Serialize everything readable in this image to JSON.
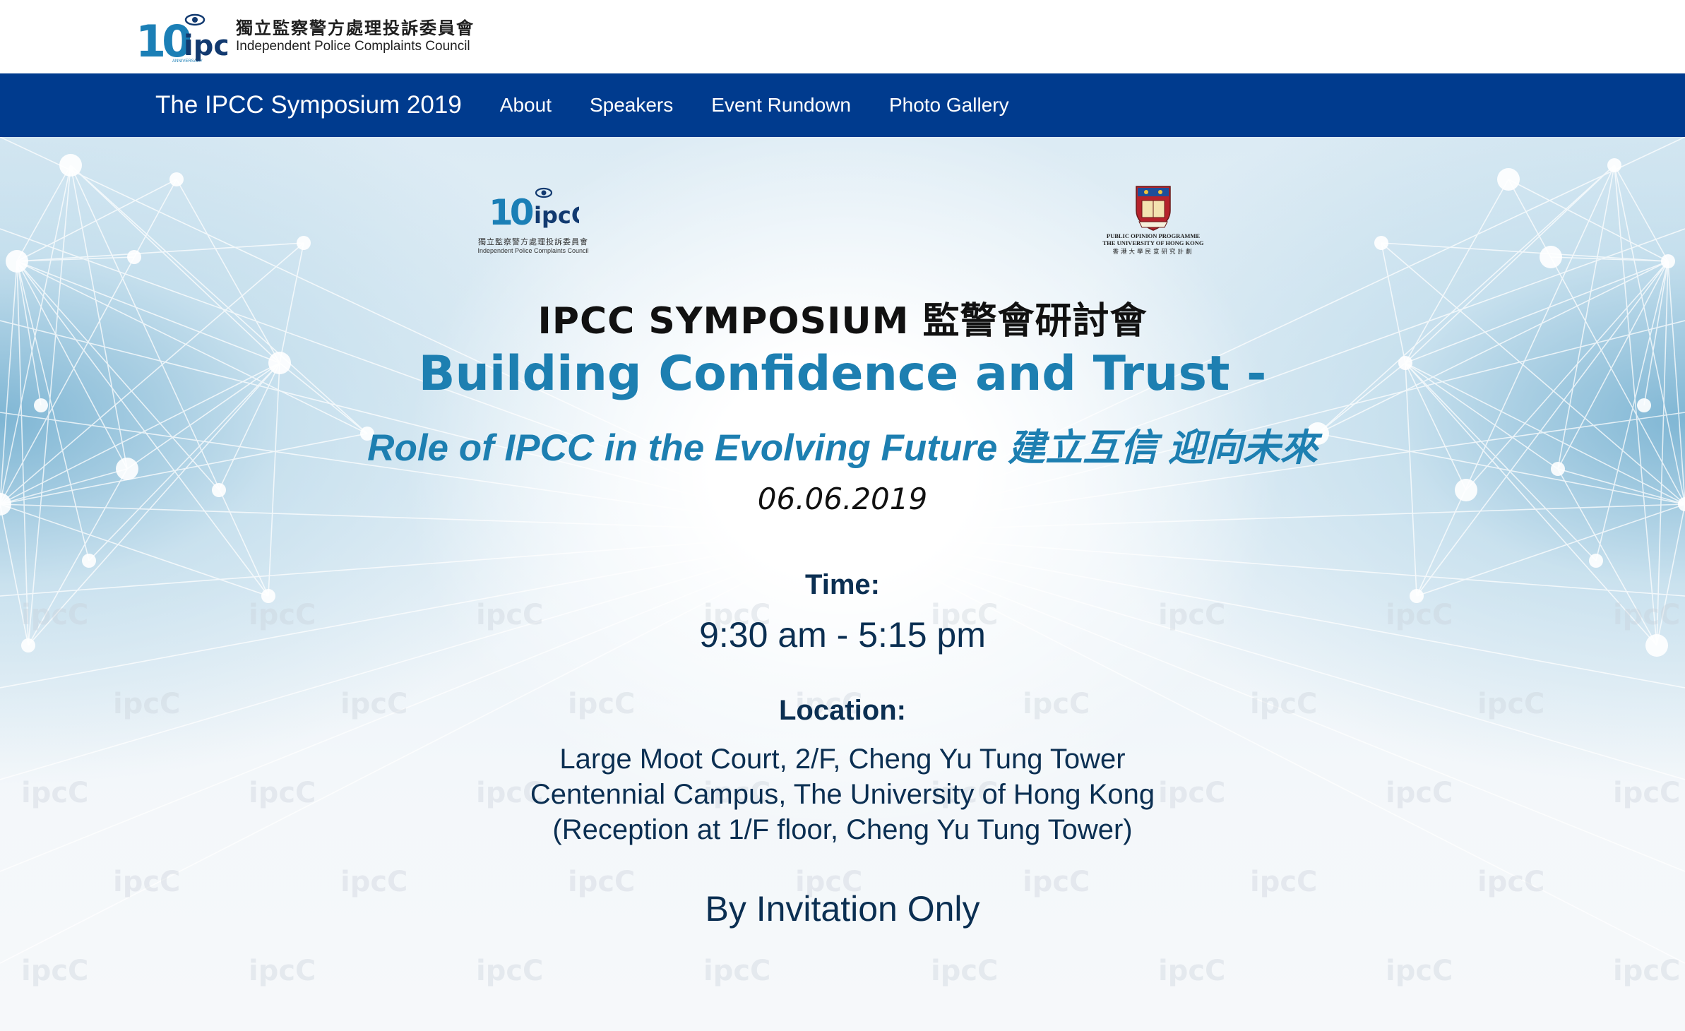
{
  "header": {
    "logo_chinese": "獨立監察警方處理投訴委員會",
    "logo_english": "Independent Police Complaints Council",
    "anniversary_mark": "10",
    "anniversary_small": "ANNIVERSARY"
  },
  "nav": {
    "title": "The IPCC Symposium 2019",
    "links": [
      "About",
      "Speakers",
      "Event Rundown",
      "Photo Gallery"
    ]
  },
  "hero": {
    "ipcc_logo": {
      "chinese": "獨立監察警方處理投訴委員會",
      "english": "Independent Police Complaints Council"
    },
    "hku_logo": {
      "line1": "PUBLIC OPINION PROGRAMME",
      "line2": "THE UNIVERSITY OF HONG KONG",
      "line3": "香港大學民意研究計劃"
    },
    "symposium_title": "IPCC SYMPOSIUM 監警會研討會",
    "main_title": "Building Confidence and Trust -",
    "subtitle": "Role of IPCC in the Evolving Future 建立互信 迎向未來",
    "date": "06.06.2019",
    "time_label": "Time:",
    "time_value": "9:30 am - 5:15 pm",
    "location_label": "Location:",
    "location_lines": [
      "Large Moot Court, 2/F, Cheng Yu Tung Tower",
      "Centennial Campus, The University of Hong Kong",
      "(Reception at 1/F floor, Cheng Yu Tung Tower)"
    ],
    "invitation": "By Invitation Only"
  },
  "colors": {
    "nav_bg": "#003b8e",
    "title_blue": "#1d7fb1",
    "body_navy": "#0b2f52"
  }
}
